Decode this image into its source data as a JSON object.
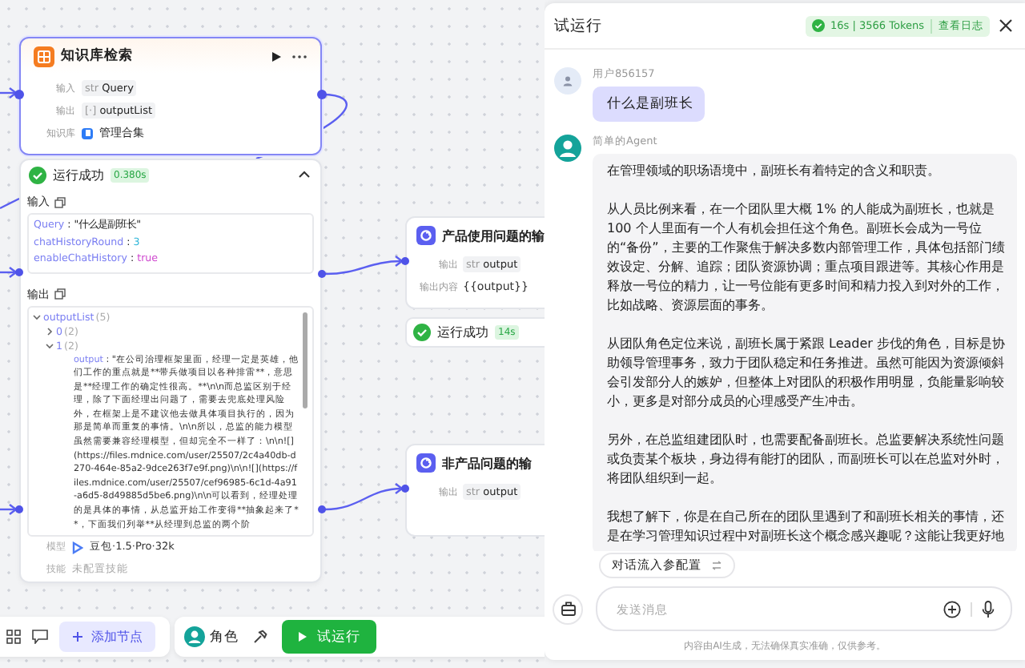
{
  "knowledge_node": {
    "title": "知识库检索",
    "selected": true,
    "rows": [
      {
        "kind": "var",
        "label": "输入",
        "tag": "str",
        "value": "Query"
      },
      {
        "kind": "var",
        "label": "输出",
        "tag": "[·]",
        "value": "outputList"
      },
      {
        "kind": "kb",
        "label": "知识库",
        "value": "管理合集"
      }
    ]
  },
  "run_result": {
    "status": "运行成功",
    "time": "0.380s",
    "expanded": true,
    "separator": ":",
    "input_label": "输入",
    "inputs": [
      {
        "key": "Query",
        "value": "\"什么是副班长\"",
        "kind": "string"
      },
      {
        "key": "chatHistoryRound",
        "value": "3",
        "kind": "number"
      },
      {
        "key": "enableChatHistory",
        "value": "true",
        "kind": "boolean"
      }
    ],
    "output_label": "输出",
    "output_tree": [
      {
        "key": "outputList",
        "count": "(5)",
        "expanded": true,
        "children": [
          {
            "key": "0",
            "count": "(2)",
            "expanded": false
          },
          {
            "key": "1",
            "count": "(2)",
            "expanded": true,
            "children": [
              {
                "key": "output",
                "value": "\"在公司治理框架里面，经理一定是英雄，他们工作的重点就是**带兵做项目以各种排雷**，意思是**经理工作的确定性很高。**\\n\\n而总监区别于经理，除了下面经理出问题了，需要去兜底处理风险外，在框架上是不建议他去做具体项目执行的，因为那是简单而重复的事情。\\n\\n所以，总监的能力模型虽然需要兼容经理模型，但却完全不一样了：\\n\\n![](https://files.mdnice.com/user/25507/2c4a40db-d270-464e-85a2-9dce263f7e9f.png)\\n\\n![](https://files.mdnice.com/user/25507/cef96985-6c1d-4a91-a6d5-8d49885d5be6.png)\\n\\n可以看到，经理处理的是具体的事情，从总监开始工作变得**抽象起来了**，下面我们列举**从经理到总监的两个阶"
              }
            ]
          }
        ]
      }
    ],
    "settings": [
      {
        "kind": "model",
        "label": "模型",
        "value": "豆包·1.5·Pro·32k"
      },
      {
        "kind": "empty",
        "label": "技能",
        "value": "未配置技能"
      }
    ]
  },
  "output_nodes": [
    {
      "title": "产品使用问题的输",
      "rows": [
        {
          "label": "输出",
          "tag": "str",
          "value": "output"
        },
        {
          "label": "输出内容",
          "value": "{{output}}"
        }
      ],
      "run": {
        "status": "运行成功",
        "time": "14s"
      }
    },
    {
      "title": "非产品问题的输",
      "rows": [
        {
          "label": "输出",
          "tag": "str",
          "value": "output"
        }
      ]
    }
  ],
  "toolbar": {
    "add_node": "添加节点",
    "role": "角色",
    "test_run": "试运行"
  },
  "panel": {
    "title": "试运行",
    "stats": "16s | 3566 Tokens",
    "log_link": "查看日志",
    "messages": [
      {
        "kind": "user",
        "name": "用户856157",
        "paragraphs": [
          "什么是副班长"
        ]
      },
      {
        "kind": "agent",
        "name": "简单的Agent",
        "paragraphs": [
          "在管理领域的职场语境中，副班长有着特定的含义和职责。",
          "从人员比例来看，在一个团队里大概 1% 的人能成为副班长，也就是 100 个人里面有一个人有机会担任这个角色。副班长会成为一号位的“备份”，主要的工作聚焦于解决多数内部管理工作，具体包括部门绩效设定、分解、追踪；团队资源协调；重点项目跟进等。其核心作用是释放一号位的精力，让一号位能有更多时间和精力投入到对外的工作，比如战略、资源层面的事务。",
          "从团队角色定位来说，副班长属于紧跟 Leader 步伐的角色，目标是协助领导管理事务，致力于团队稳定和任务推进。虽然可能因为资源倾斜会引发部分人的嫉妒，但整体上对团队的积极作用明显，负能量影响较小，更多是对部分成员的心理感受产生冲击。",
          "另外，在总监组建团队时，也需要配备副班长。总监要解决系统性问题或负责某个板块，身边得有能打的团队，而副班长可以在总监对外时，将团队组织到一起。",
          "我想了解下，你是在自己所在的团队里遇到了和副班长相关的事情，还是在学习管理知识过程中对副班长这个概念感兴趣呢？这能让我更好地"
        ]
      }
    ],
    "config_chip": "对话流入参配置",
    "input": {
      "placeholder": "发送消息"
    },
    "disclaimer": "内容由AI生成，无法确保真实准确，仅供参考。"
  }
}
